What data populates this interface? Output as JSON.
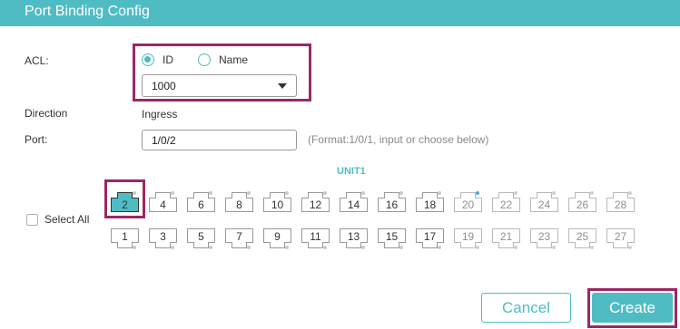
{
  "dialog": {
    "title": "Port Binding Config"
  },
  "acl": {
    "label": "ACL:",
    "options": [
      {
        "label": "ID",
        "selected": true
      },
      {
        "label": "Name",
        "selected": false
      }
    ],
    "select_value": "1000"
  },
  "direction": {
    "label": "Direction",
    "value": "Ingress"
  },
  "port": {
    "label": "Port:",
    "value": "1/0/2",
    "hint": "(Format:1/0/1, input or choose below)"
  },
  "unit_label": "UNIT1",
  "select_all_label": "Select All",
  "ports": {
    "top_row": [
      {
        "num": "2",
        "selected": true,
        "dim": false,
        "link_up": false
      },
      {
        "num": "4",
        "selected": false,
        "dim": false,
        "link_up": false
      },
      {
        "num": "6",
        "selected": false,
        "dim": false,
        "link_up": false
      },
      {
        "num": "8",
        "selected": false,
        "dim": false,
        "link_up": false
      },
      {
        "num": "10",
        "selected": false,
        "dim": false,
        "link_up": false
      },
      {
        "num": "12",
        "selected": false,
        "dim": false,
        "link_up": false
      },
      {
        "num": "14",
        "selected": false,
        "dim": false,
        "link_up": false
      },
      {
        "num": "16",
        "selected": false,
        "dim": false,
        "link_up": false
      },
      {
        "num": "18",
        "selected": false,
        "dim": false,
        "link_up": false
      },
      {
        "num": "20",
        "selected": false,
        "dim": true,
        "link_up": true
      },
      {
        "num": "22",
        "selected": false,
        "dim": true,
        "link_up": false
      },
      {
        "num": "24",
        "selected": false,
        "dim": true,
        "link_up": false
      },
      {
        "num": "26",
        "selected": false,
        "dim": true,
        "link_up": false
      },
      {
        "num": "28",
        "selected": false,
        "dim": true,
        "link_up": false
      }
    ],
    "bottom_row": [
      {
        "num": "1",
        "selected": false,
        "dim": false
      },
      {
        "num": "3",
        "selected": false,
        "dim": false
      },
      {
        "num": "5",
        "selected": false,
        "dim": false
      },
      {
        "num": "7",
        "selected": false,
        "dim": false
      },
      {
        "num": "9",
        "selected": false,
        "dim": false
      },
      {
        "num": "11",
        "selected": false,
        "dim": false
      },
      {
        "num": "13",
        "selected": false,
        "dim": false
      },
      {
        "num": "15",
        "selected": false,
        "dim": false
      },
      {
        "num": "17",
        "selected": false,
        "dim": false
      },
      {
        "num": "19",
        "selected": false,
        "dim": true
      },
      {
        "num": "21",
        "selected": false,
        "dim": true
      },
      {
        "num": "23",
        "selected": false,
        "dim": true
      },
      {
        "num": "25",
        "selected": false,
        "dim": true
      },
      {
        "num": "27",
        "selected": false,
        "dim": true
      }
    ]
  },
  "buttons": {
    "cancel": "Cancel",
    "create": "Create"
  },
  "colors": {
    "accent": "#4fbcc4",
    "highlight": "#9c2765",
    "link_up": "#4aa8e0"
  }
}
